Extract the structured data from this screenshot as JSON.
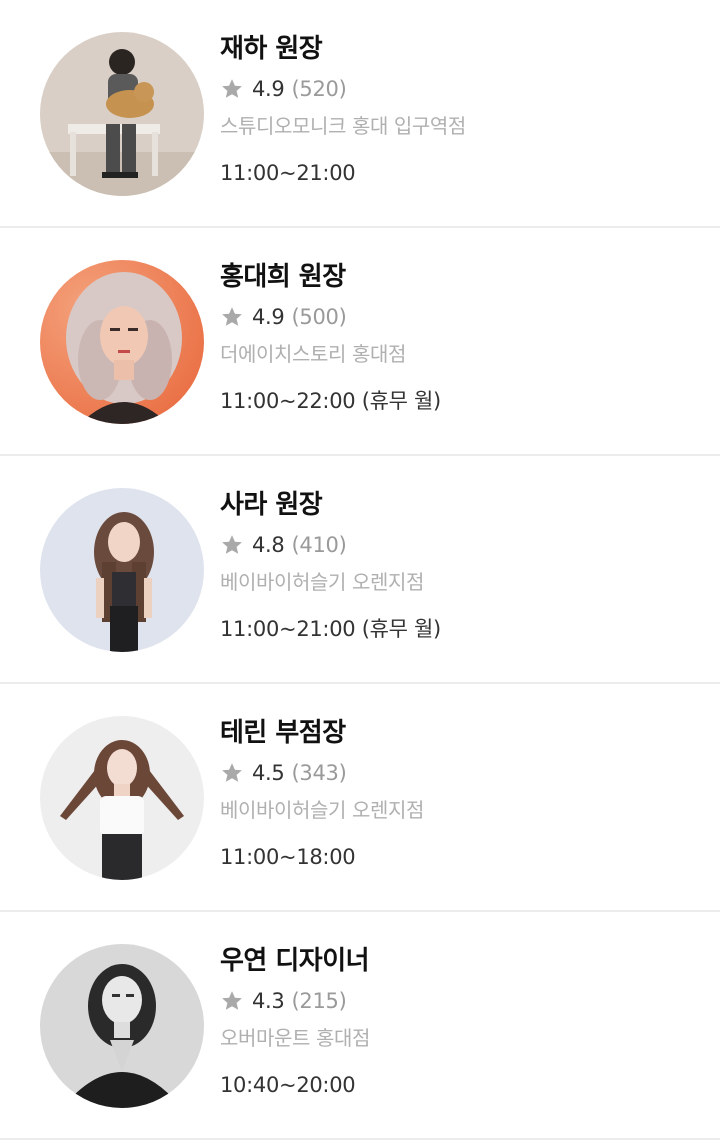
{
  "designers": [
    {
      "name": "재하 원장",
      "rating": "4.9",
      "review_count": "(520)",
      "shop": "스튜디오모니크 홍대 입구역점",
      "hours": "11:00~21:00",
      "photo": "man-with-dog-photo"
    },
    {
      "name": "홍대희 원장",
      "rating": "4.9",
      "review_count": "(500)",
      "shop": "더에이치스토리 홍대점",
      "hours": "11:00~22:00 (휴무 월)",
      "photo": "curly-hair-woman-photo"
    },
    {
      "name": "사라 원장",
      "rating": "4.8",
      "review_count": "(410)",
      "shop": "베이바이허슬기 오렌지점",
      "hours": "11:00~21:00 (휴무 월)",
      "photo": "woman-long-hair-photo"
    },
    {
      "name": "테린 부점장",
      "rating": "4.5",
      "review_count": "(343)",
      "shop": "베이바이허슬기 오렌지점",
      "hours": "11:00~18:00",
      "photo": "woman-white-top-photo"
    },
    {
      "name": "우연 디자이너",
      "rating": "4.3",
      "review_count": "(215)",
      "shop": "오버마운트 홍대점",
      "hours": "10:40~20:00",
      "photo": "woman-monochrome-photo"
    }
  ],
  "colors": {
    "star": "#a9a9a9",
    "name": "#111111",
    "shop": "#b0b0b0",
    "divider": "#ececec"
  }
}
